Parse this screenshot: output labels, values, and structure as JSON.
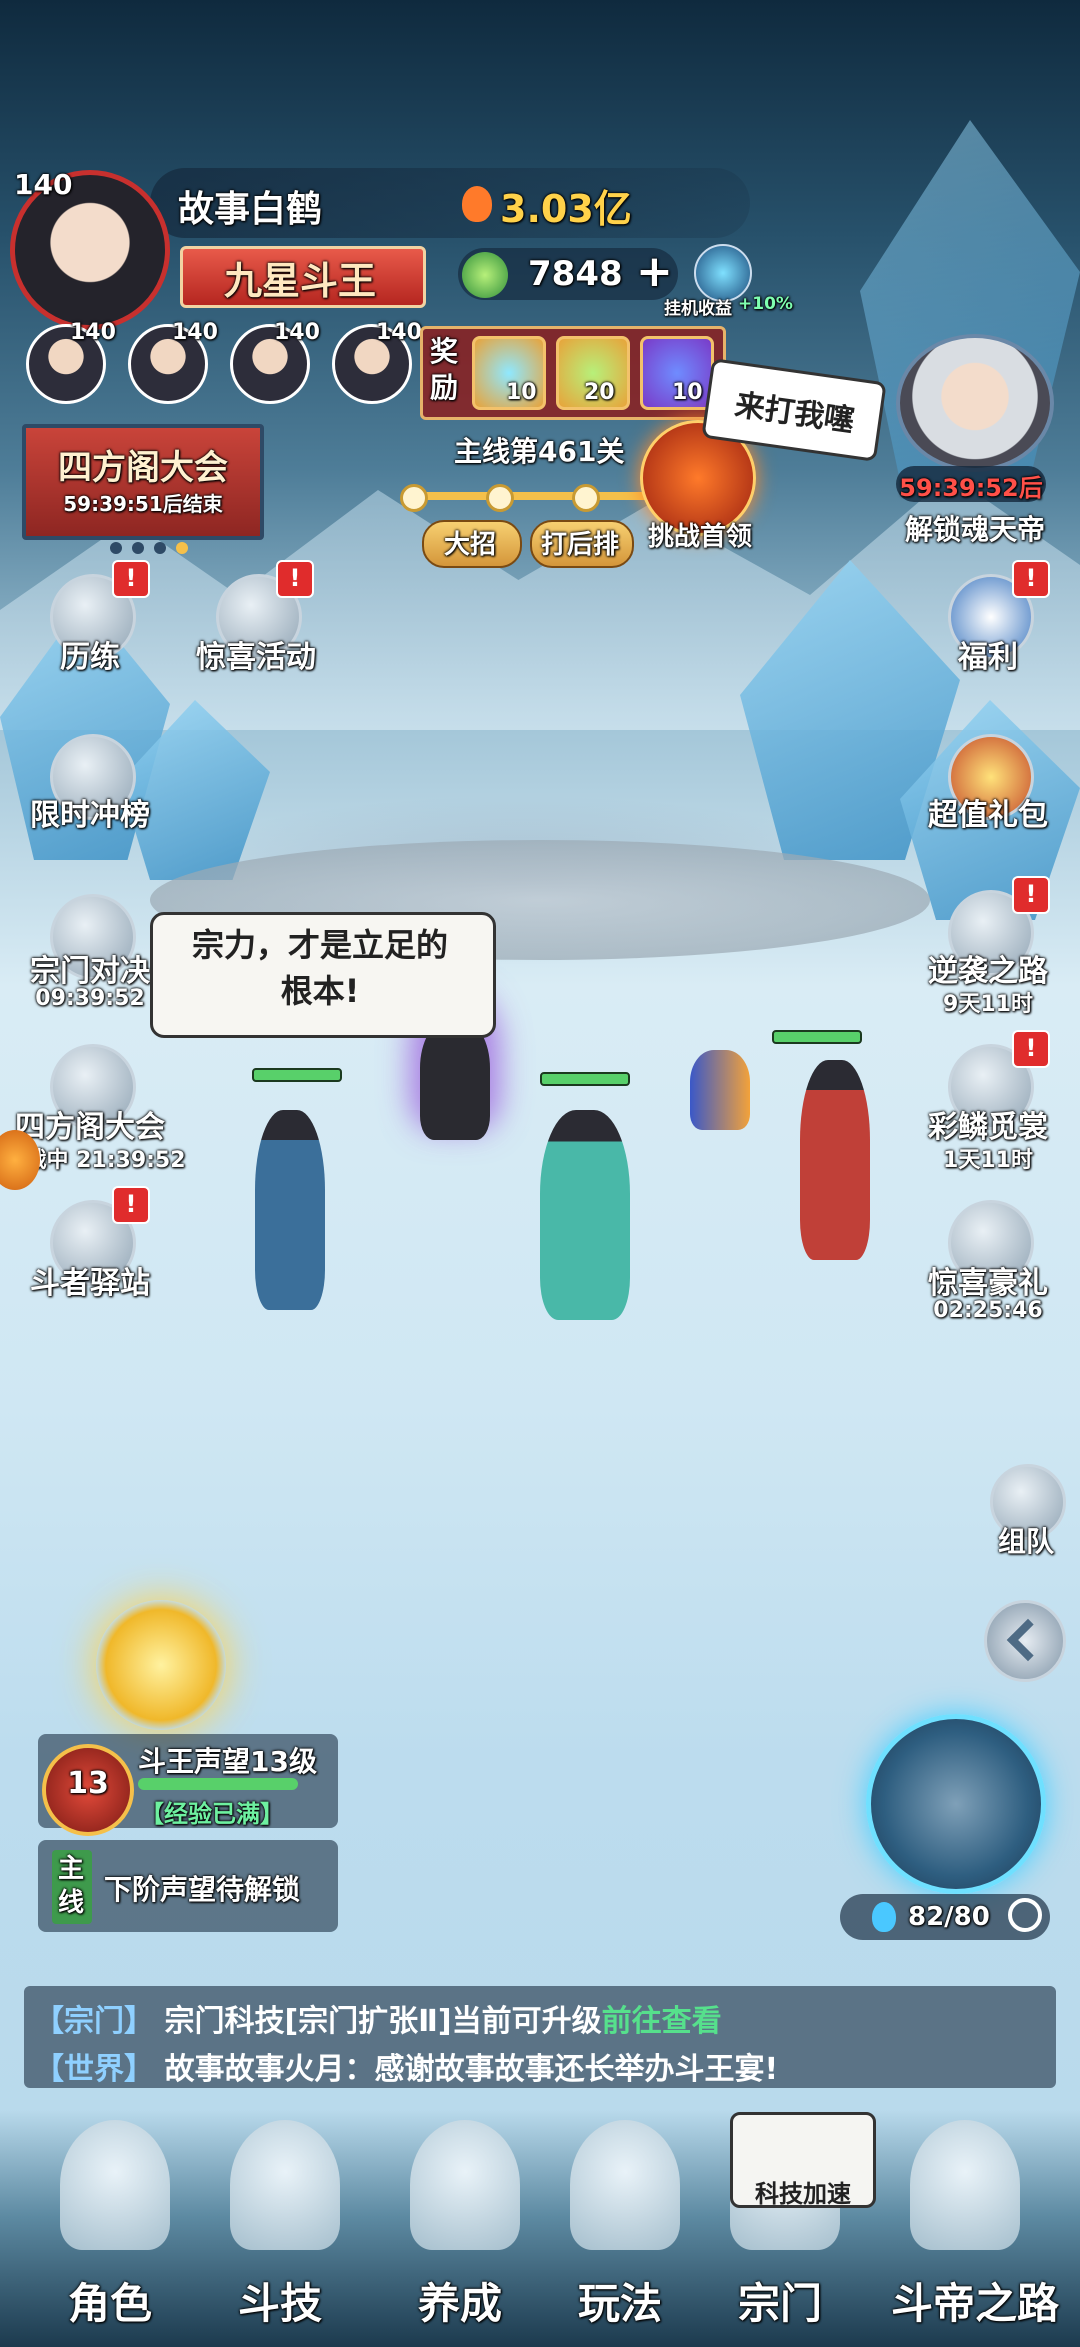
{
  "player": {
    "level": "140",
    "name": "故事白鹤",
    "power": "3.03亿",
    "title": "九星斗王",
    "currency": "7848",
    "idle_label": "挂机收益",
    "idle_bonus": "+10%"
  },
  "team": [
    {
      "level": "140"
    },
    {
      "level": "140"
    },
    {
      "level": "140"
    },
    {
      "level": "140"
    }
  ],
  "rewards": {
    "label": "奖励",
    "items": [
      {
        "count": "10",
        "icon": "blue-flame-icon"
      },
      {
        "count": "20",
        "icon": "green-swirl-icon"
      },
      {
        "count": "10",
        "icon": "purple-orb-icon"
      }
    ]
  },
  "stage": {
    "name": "主线第461关",
    "btn_ultimate": "大招",
    "btn_back": "打后排",
    "boss_speech": "来打我噻",
    "challenge": "挑战首领"
  },
  "event_banner": {
    "title": "四方阁大会",
    "timer": "59:39:51后结束"
  },
  "boss_unlock": {
    "timer": "59:39:52后",
    "label": "解锁魂天帝"
  },
  "left_menu": [
    {
      "label": "历练",
      "icon": "scroll-hand-icon",
      "badge": "!"
    },
    {
      "label": "惊喜活动",
      "icon": "gift-icon",
      "badge": "!"
    },
    {
      "label": "限时冲榜",
      "icon": "ranking-icon"
    },
    {
      "label": "宗门对决",
      "timer": "09:39:52",
      "icon": "sect-duel-icon"
    },
    {
      "label": "四方阁大会",
      "timer": "备战中 21:39:52",
      "icon": "flame-badge-icon"
    },
    {
      "label": "斗者驿站",
      "icon": "station-icon",
      "badge": "!"
    }
  ],
  "right_menu": [
    {
      "label": "福利",
      "icon": "swirl-icon",
      "badge": "!"
    },
    {
      "label": "超值礼包",
      "icon": "treasure-chest-icon"
    },
    {
      "label": "逆袭之路",
      "timer": "9天11时",
      "icon": "characters-icon",
      "badge": "!"
    },
    {
      "label": "彩鳞觅裳",
      "timer": "1天11时",
      "icon": "queen-icon",
      "badge": "!"
    },
    {
      "label": "惊喜豪礼",
      "timer": "02:25:46",
      "icon": "bag-icon"
    },
    {
      "label": "组队",
      "icon": "flag-icon"
    }
  ],
  "speech_bubble": "宗力，才是立足的\n根本!",
  "reputation": {
    "level": "13",
    "title": "斗王声望13级",
    "status": "【经验已满】"
  },
  "quest": {
    "tag": "主线",
    "text": "下阶声望待解锁"
  },
  "stamina": "82/80",
  "chat": [
    {
      "channel": "【宗门】",
      "text": "宗门科技[宗门扩张Ⅱ]当前可升级",
      "link": "前往查看"
    },
    {
      "channel": "【世界】",
      "text": "故事故事火月：感谢故事故事还长举办斗王宴!"
    }
  ],
  "nav": [
    {
      "label": "角色",
      "icon": "character-icon"
    },
    {
      "label": "斗技",
      "icon": "scroll-icon"
    },
    {
      "label": "养成",
      "icon": "growth-icon"
    },
    {
      "label": "玩法",
      "icon": "gameplay-icon"
    },
    {
      "label": "宗门",
      "icon": "sect-icon",
      "tag": "科技加速"
    },
    {
      "label": "斗帝之路",
      "icon": "flame-path-icon"
    }
  ],
  "colors": {
    "accent_red": "#c8302e",
    "gold": "#f5c04a",
    "link_green": "#56e08c",
    "hp_green": "#58d06a"
  }
}
